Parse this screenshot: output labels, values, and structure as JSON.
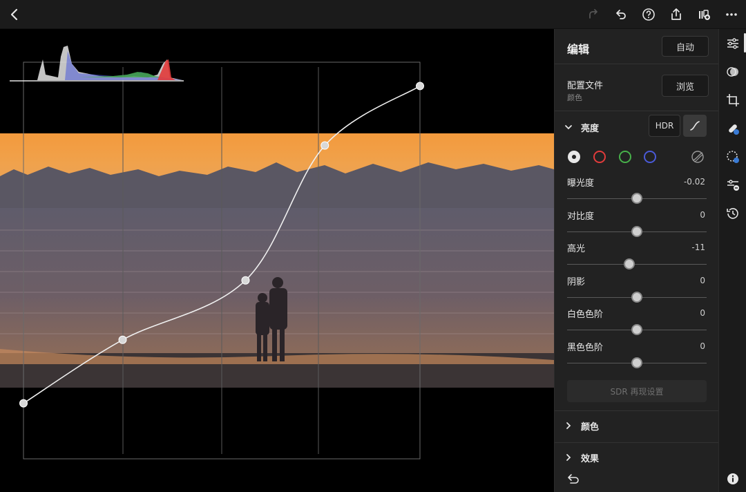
{
  "toolbar": {
    "back_icon": "chevron-left-icon",
    "redo_icon": "redo-icon",
    "undo_icon": "undo-icon",
    "help_icon": "help-icon",
    "share_icon": "share-icon",
    "add_to_album_icon": "add-to-album-icon",
    "more_icon": "more-icon"
  },
  "panel": {
    "title": "编辑",
    "auto_label": "自动",
    "profile": {
      "label": "配置文件",
      "value": "颜色",
      "browse_label": "浏览"
    },
    "light": {
      "label": "亮度",
      "hdr_label": "HDR",
      "sliders": [
        {
          "label": "曝光度",
          "value": "-0.02",
          "level": 0.498
        },
        {
          "label": "对比度",
          "value": "0",
          "level": 0.5
        },
        {
          "label": "高光",
          "value": "-11",
          "level": 0.445
        },
        {
          "label": "阴影",
          "value": "0",
          "level": 0.5
        },
        {
          "label": "白色色阶",
          "value": "0",
          "level": 0.5
        },
        {
          "label": "黑色色阶",
          "value": "0",
          "level": 0.5
        }
      ],
      "sdr_label": "SDR 再现设置"
    },
    "color_section": "颜色",
    "effects_section": "效果"
  },
  "colors": {
    "channel_white": "#e8e8e8",
    "channel_red": "#e23b3b",
    "channel_green": "#47b04a",
    "channel_blue": "#4a5ad8"
  },
  "curve": {
    "points": [
      [
        0,
        0.14
      ],
      [
        0.25,
        0.3
      ],
      [
        0.56,
        0.45
      ],
      [
        0.76,
        0.79
      ],
      [
        1.0,
        0.94
      ]
    ]
  },
  "rail": {
    "icons": [
      "sliders-icon",
      "presets-icon",
      "crop-icon",
      "healing-icon",
      "masking-icon",
      "versions-icon",
      "history-icon",
      "info-icon"
    ]
  },
  "footer": {
    "reset_icon": "reset-icon"
  }
}
